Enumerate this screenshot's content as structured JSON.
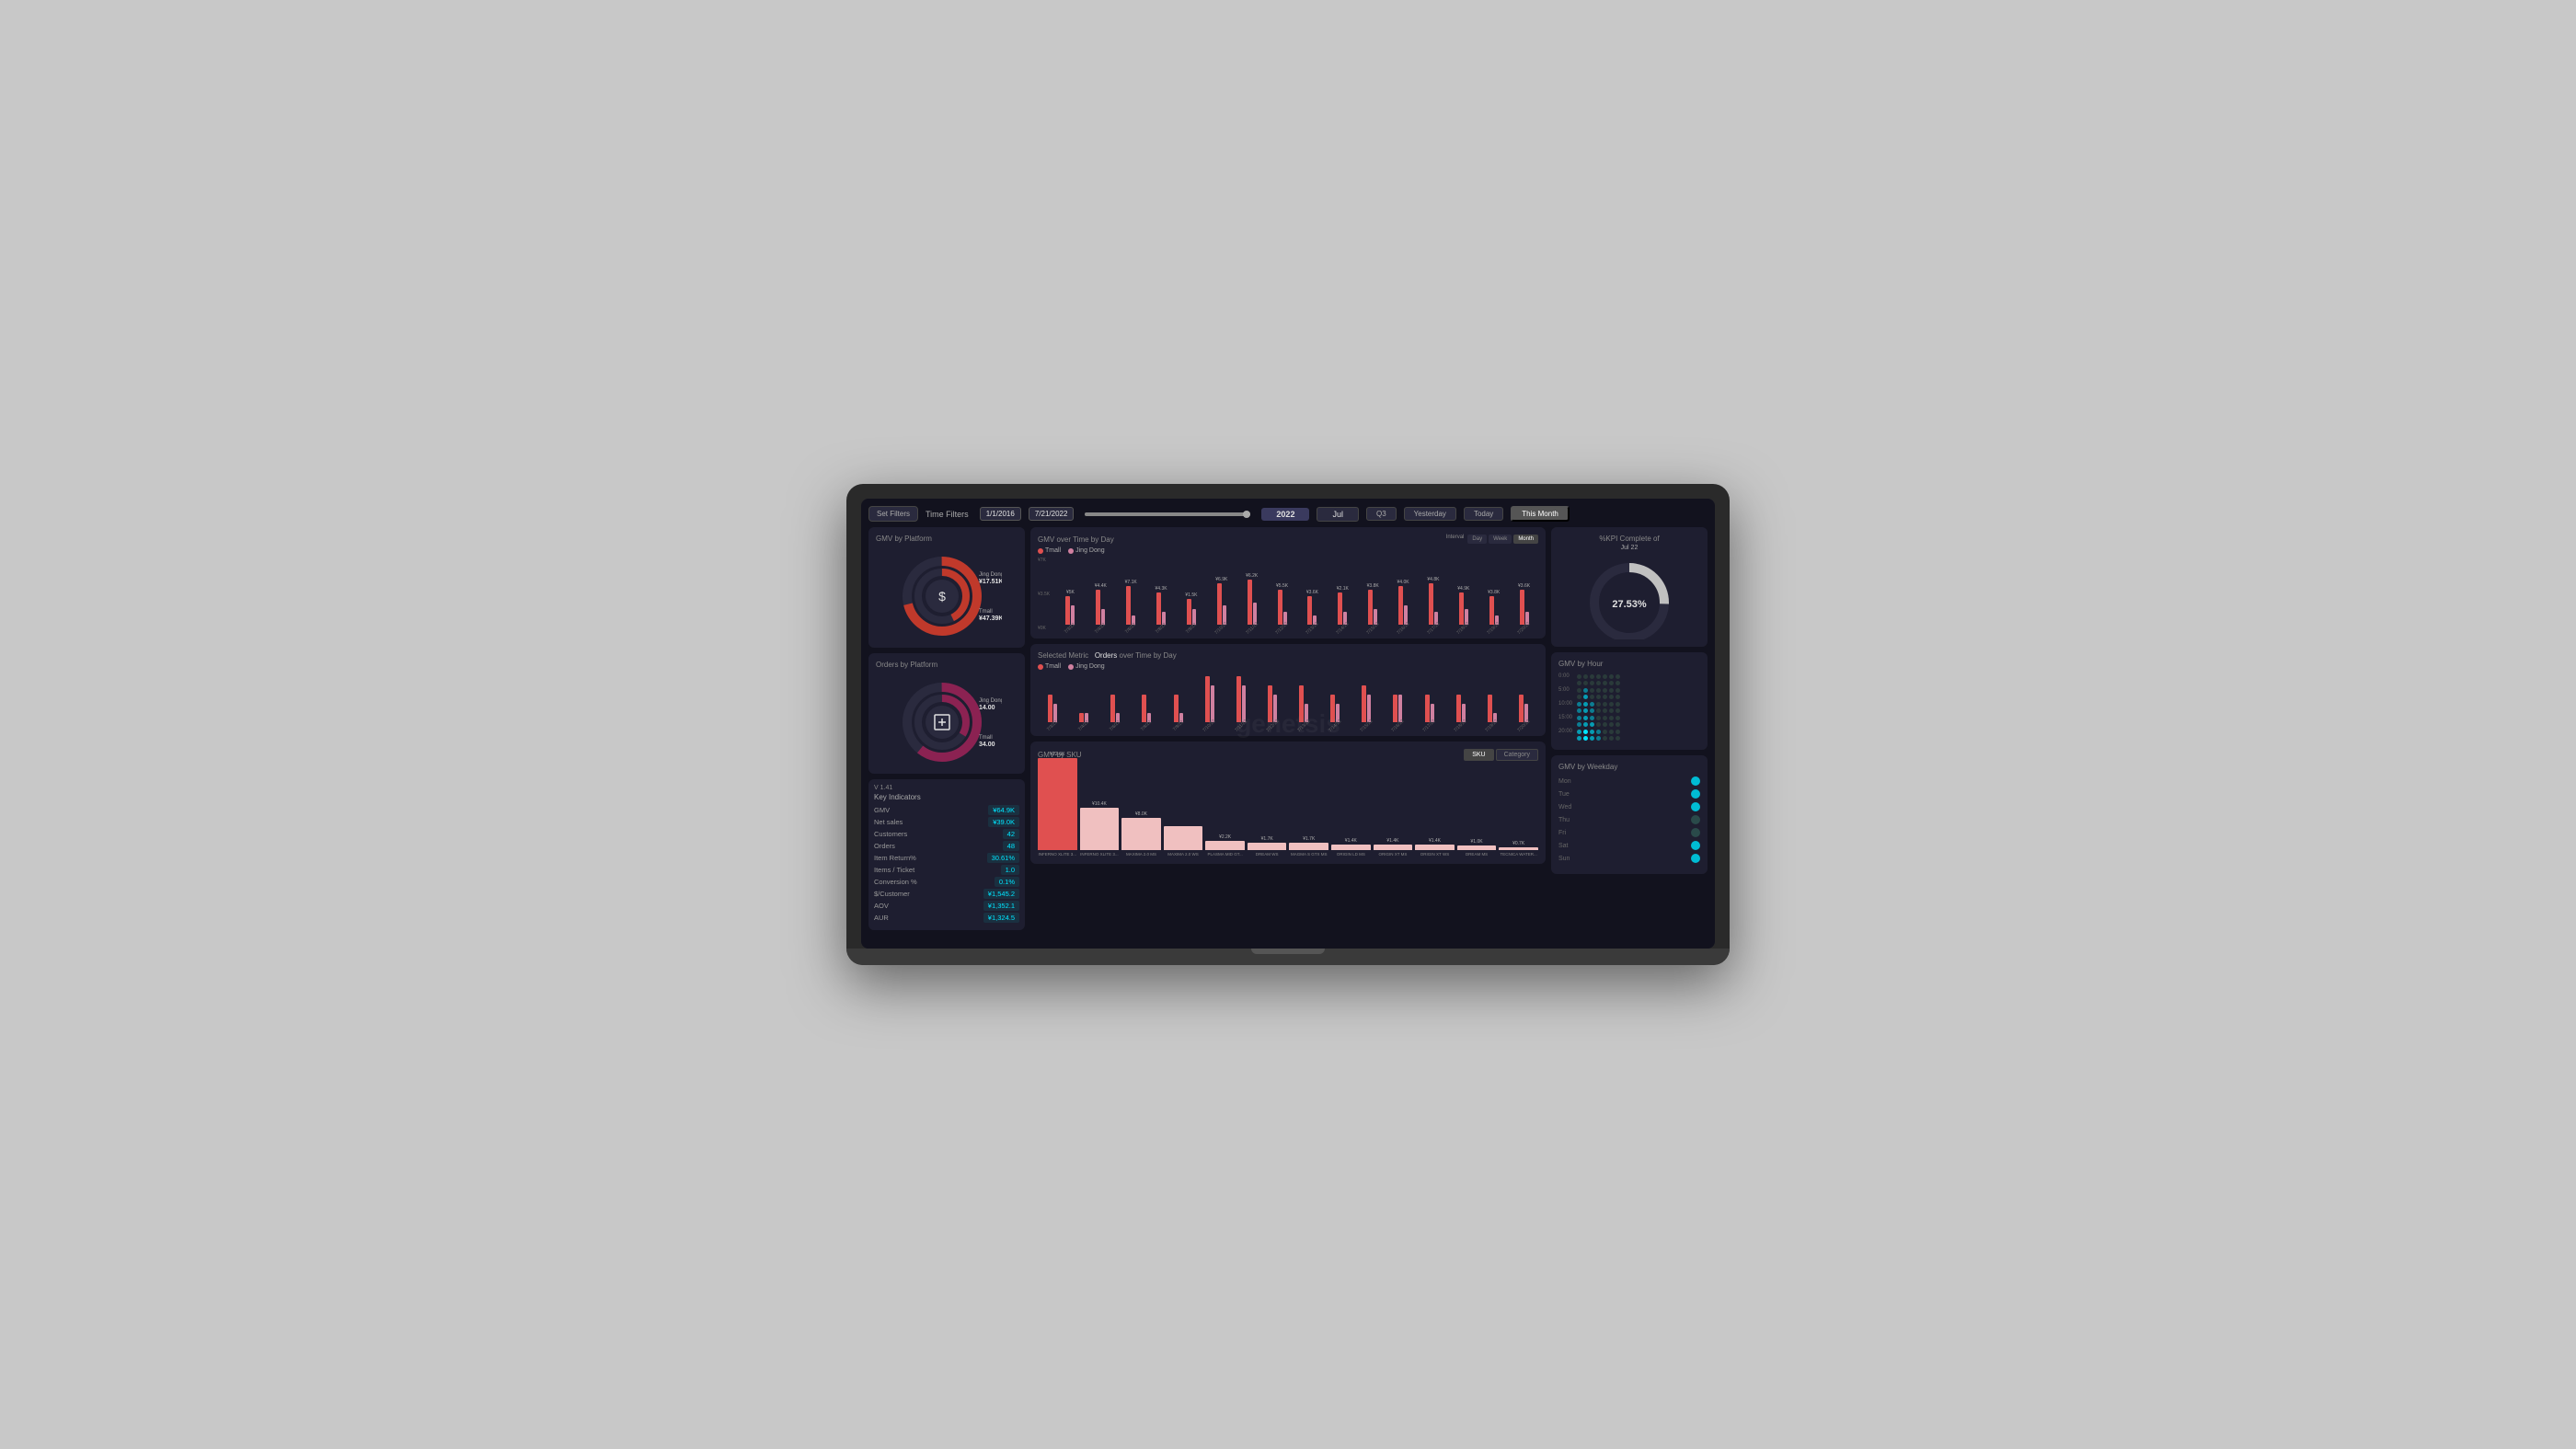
{
  "topBar": {
    "setFiltersLabel": "Set Filters",
    "timeFiltersLabel": "Time Filters",
    "startDate": "1/1/2016",
    "endDate": "7/21/2022",
    "year": "2022",
    "month": "Jul",
    "q3Label": "Q3",
    "yesterdayLabel": "Yesterday",
    "todayLabel": "Today",
    "thisMonthLabel": "This Month"
  },
  "gmvPlatform": {
    "title": "GMV by Platform",
    "jingDongLabel": "Jing Dong",
    "jingDongValue": "¥17.51K",
    "tmallLabel": "Tmall",
    "tmallValue": "¥47.39K"
  },
  "ordersPlatform": {
    "title": "Orders by Platform",
    "jingDongLabel": "Jing Dong",
    "jingDongValue": "14.00",
    "tmallLabel": "Tmall",
    "tmallValue": "34.00"
  },
  "keyIndicators": {
    "version": "V 1.41",
    "title": "Key Indicators",
    "rows": [
      {
        "label": "GMV",
        "value": "¥64.9K"
      },
      {
        "label": "Net sales",
        "value": "¥39.0K"
      },
      {
        "label": "Customers",
        "value": "42"
      },
      {
        "label": "Orders",
        "value": "48"
      },
      {
        "label": "Item Return%",
        "value": "30.61%"
      },
      {
        "label": "Items / Ticket",
        "value": "1.0"
      },
      {
        "label": "Conversion %",
        "value": "0.1%"
      },
      {
        "label": "$/Customer",
        "value": "¥1,545.2"
      },
      {
        "label": "AOV",
        "value": "¥1,352.1"
      },
      {
        "label": "AUR",
        "value": "¥1,324.5"
      }
    ]
  },
  "gmvOverTime": {
    "title": "GMV over Time by Day",
    "legend": [
      "Tmall",
      "Jing Dong"
    ],
    "intervalLabel": "Interval",
    "intervalOptions": [
      "Day",
      "Week",
      "Month"
    ],
    "activeInterval": "Month",
    "bars": [
      {
        "date": "7/3/2022",
        "tmall": 45,
        "jd": 30,
        "topLabel": "¥5K"
      },
      {
        "date": "7/4/2022",
        "tmall": 55,
        "jd": 25,
        "topLabel": "¥4.4K"
      },
      {
        "date": "7/6/2022",
        "tmall": 60,
        "jd": 15,
        "topLabel": "¥7.1K"
      },
      {
        "date": "7/8/2022",
        "tmall": 50,
        "jd": 20,
        "topLabel": "¥4.3K"
      },
      {
        "date": "7/9/2022",
        "tmall": 40,
        "jd": 25,
        "topLabel": "¥1.5K"
      },
      {
        "date": "7/10/2022",
        "tmall": 65,
        "jd": 30,
        "topLabel": "¥6.9K"
      },
      {
        "date": "7/11/2022",
        "tmall": 70,
        "jd": 35,
        "topLabel": "¥6.2K"
      },
      {
        "date": "7/12/2022",
        "tmall": 55,
        "jd": 20,
        "topLabel": "¥5.5K"
      },
      {
        "date": "7/13/2022",
        "tmall": 45,
        "jd": 15,
        "topLabel": "¥3.6K"
      },
      {
        "date": "7/14/2022",
        "tmall": 50,
        "jd": 20,
        "topLabel": "¥2.1K"
      },
      {
        "date": "7/15/2022",
        "tmall": 55,
        "jd": 25,
        "topLabel": "¥3.8K"
      },
      {
        "date": "7/16/2022",
        "tmall": 60,
        "jd": 30,
        "topLabel": "¥4.0K"
      },
      {
        "date": "7/17/2022",
        "tmall": 65,
        "jd": 20,
        "topLabel": "¥4.8K"
      },
      {
        "date": "7/18/2022",
        "tmall": 50,
        "jd": 25,
        "topLabel": "¥4.9K"
      },
      {
        "date": "7/19/2022",
        "tmall": 45,
        "jd": 15,
        "topLabel": "¥3.8K"
      },
      {
        "date": "7/20/2022",
        "tmall": 55,
        "jd": 20,
        "topLabel": "¥3.6K"
      }
    ]
  },
  "ordersOverTime": {
    "title": "Selected Metric",
    "subtitle": "Orders",
    "subtitleSuffix": "over Time by Day",
    "legend": [
      "Tmall",
      "Jing Dong"
    ],
    "bars": [
      {
        "date": "7/3/2022",
        "tmall": 3,
        "jd": 2
      },
      {
        "date": "7/4/2022",
        "tmall": 1,
        "jd": 1
      },
      {
        "date": "7/6/2022",
        "tmall": 3,
        "jd": 1
      },
      {
        "date": "7/8/2022",
        "tmall": 3,
        "jd": 1
      },
      {
        "date": "7/9/2022",
        "tmall": 3,
        "jd": 1
      },
      {
        "date": "7/10/2022",
        "tmall": 5,
        "jd": 4
      },
      {
        "date": "7/11/2022",
        "tmall": 5,
        "jd": 4
      },
      {
        "date": "7/12/2022",
        "tmall": 4,
        "jd": 3
      },
      {
        "date": "7/13/2022",
        "tmall": 4,
        "jd": 2
      },
      {
        "date": "7/14/2022",
        "tmall": 3,
        "jd": 2
      },
      {
        "date": "7/15/2022",
        "tmall": 4,
        "jd": 3
      },
      {
        "date": "7/16/2022",
        "tmall": 3,
        "jd": 3
      },
      {
        "date": "7/17/2022",
        "tmall": 3,
        "jd": 2
      },
      {
        "date": "7/18/2022",
        "tmall": 3,
        "jd": 2
      },
      {
        "date": "7/19/2022",
        "tmall": 3,
        "jd": 1
      },
      {
        "date": "7/20/2022",
        "tmall": 3,
        "jd": 2
      }
    ]
  },
  "gmvBySku": {
    "title": "GMV by SKU",
    "toggleOptions": [
      "SKU",
      "Category"
    ],
    "activeToggle": "SKU",
    "bars": [
      {
        "name": "INFERNO XLITE 3...",
        "value": "¥22.6K",
        "height": 100,
        "highlight": true
      },
      {
        "name": "INFERNO XLITE 3...",
        "value": "¥10.4K",
        "height": 46,
        "highlight": false
      },
      {
        "name": "MAXIMA 2.0 MS",
        "value": "¥8.0K",
        "height": 35,
        "highlight": false
      },
      {
        "name": "MAXIMA 2.0 WS",
        "value": "",
        "height": 26,
        "highlight": false
      },
      {
        "name": "PLASMA MID GT...",
        "value": "¥2.2K",
        "height": 10,
        "highlight": false
      },
      {
        "name": "DREAM WS",
        "value": "¥1.7K",
        "height": 8,
        "highlight": false
      },
      {
        "name": "MAGMA S GTX MS",
        "value": "¥1.7K",
        "height": 8,
        "highlight": false
      },
      {
        "name": "ORIGIN LD MS",
        "value": "¥1.4K",
        "height": 6,
        "highlight": false
      },
      {
        "name": "ORIGIN XT MS",
        "value": "¥1.4K",
        "height": 6,
        "highlight": false
      },
      {
        "name": "ORIGIN XT WS",
        "value": "¥1.4K",
        "height": 6,
        "highlight": false
      },
      {
        "name": "DREAM MS",
        "value": "¥1.0K",
        "height": 5,
        "highlight": false
      },
      {
        "name": "TECNICA WATER...",
        "value": "¥0.7K",
        "height": 3,
        "highlight": false
      }
    ]
  },
  "kpiGauge": {
    "title": "%KPI Complete of",
    "date": "Jul 22",
    "value": "27.53%",
    "progress": 27.53
  },
  "gmvByHour": {
    "title": "GMV by Hour",
    "hours": [
      "0:00",
      "5:00",
      "10:00",
      "15:00",
      "20:00"
    ],
    "dotRows": [
      {
        "hour": "0:00",
        "dots": [
          0,
          0,
          0,
          0,
          0,
          0,
          0
        ]
      },
      {
        "hour": "",
        "dots": [
          0,
          0,
          0,
          0,
          0,
          0,
          0
        ]
      },
      {
        "hour": "5:00",
        "dots": [
          0,
          1,
          0,
          0,
          0,
          0,
          0
        ]
      },
      {
        "hour": "",
        "dots": [
          0,
          2,
          0,
          0,
          0,
          0,
          0
        ]
      },
      {
        "hour": "10:00",
        "dots": [
          1,
          2,
          1,
          0,
          0,
          0,
          0
        ]
      },
      {
        "hour": "",
        "dots": [
          1,
          2,
          1,
          0,
          0,
          0,
          0
        ]
      },
      {
        "hour": "15:00",
        "dots": [
          1,
          2,
          1,
          0,
          0,
          0,
          0
        ]
      },
      {
        "hour": "",
        "dots": [
          1,
          2,
          2,
          0,
          0,
          0,
          0
        ]
      },
      {
        "hour": "20:00",
        "dots": [
          2,
          3,
          2,
          1,
          0,
          0,
          0
        ]
      },
      {
        "hour": "",
        "dots": [
          2,
          3,
          2,
          1,
          0,
          0,
          0
        ]
      }
    ]
  },
  "gmvByWeekday": {
    "title": "GMV by Weekday",
    "days": [
      {
        "label": "Mon",
        "active": true
      },
      {
        "label": "Tue",
        "active": true
      },
      {
        "label": "Wed",
        "active": true
      },
      {
        "label": "Thu",
        "active": false
      },
      {
        "label": "Fri",
        "active": false
      },
      {
        "label": "Sat",
        "active": true
      },
      {
        "label": "Sun",
        "active": true
      }
    ]
  },
  "watermark": "genetsis"
}
